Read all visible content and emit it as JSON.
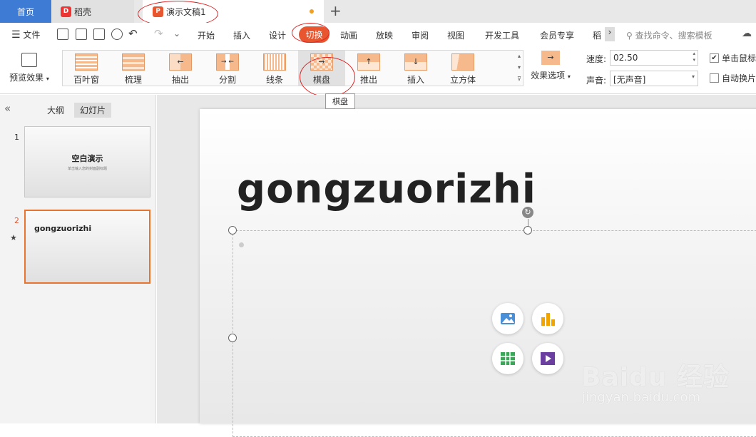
{
  "tabs": {
    "home": "首页",
    "daoke": "稻壳",
    "doc": "演示文稿1"
  },
  "menu": {
    "file": "文件",
    "items": [
      "开始",
      "插入",
      "设计",
      "切换",
      "动画",
      "放映",
      "审阅",
      "视图",
      "开发工具",
      "会员专享",
      "稻"
    ],
    "search": "查找命令、搜索模板"
  },
  "ribbon": {
    "preview": "预览效果",
    "effects": [
      "百叶窗",
      "梳理",
      "抽出",
      "分割",
      "线条",
      "棋盘",
      "推出",
      "插入",
      "立方体"
    ],
    "effect_options": "效果选项",
    "speed_label": "速度:",
    "speed_value": "02.50",
    "sound_label": "声音:",
    "sound_value": "[无声音]",
    "click_advance": "单击鼠标",
    "auto_advance": "自动换片"
  },
  "tooltip": "棋盘",
  "panel": {
    "outline_tab": "大纲",
    "slides_tab": "幻灯片",
    "slides": [
      {
        "num": "1",
        "title": "空白演示",
        "subtitle": "单击输入您的封面副标题"
      },
      {
        "num": "2",
        "title": "gongzuorizhi"
      }
    ]
  },
  "slide": {
    "title": "gongzuorizhi"
  },
  "watermark": {
    "brand": "Baidu 经验",
    "url": "jingyan.baidu.com"
  },
  "colors": {
    "accent": "#e8562f",
    "home_tab": "#3d7bd5"
  }
}
